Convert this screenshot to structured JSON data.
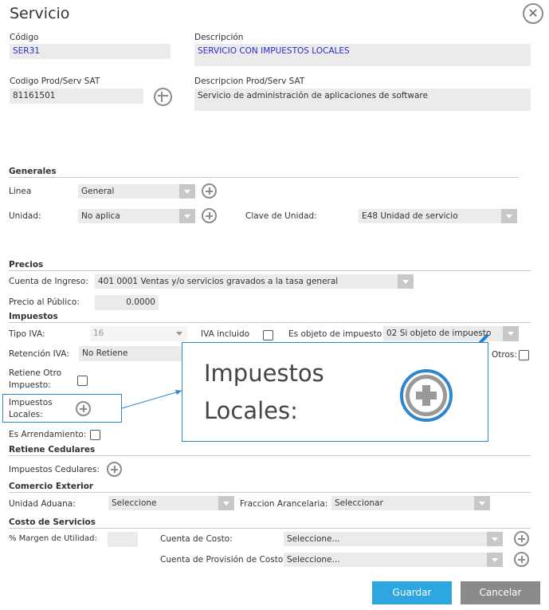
{
  "dialog": {
    "title": "Servicio",
    "close_icon": "close-icon"
  },
  "top": {
    "codigo_label": "Código",
    "codigo_value": "SER31",
    "descripcion_label": "Descripción",
    "descripcion_value": "SERVICIO CON IMPUESTOS LOCALES",
    "codigo_sat_label": "Codigo Prod/Serv SAT",
    "codigo_sat_value": "81161501",
    "desc_sat_label": "Descripcion Prod/Serv SAT",
    "desc_sat_value": "Servicio de administración de aplicaciones de software"
  },
  "generales": {
    "title": "Generales",
    "linea_label": "Linea",
    "linea_value": "General",
    "unidad_label": "Unidad:",
    "unidad_value": "No aplica",
    "clave_unidad_label": "Clave de Unidad:",
    "clave_unidad_value": "E48 Unidad de servicio"
  },
  "precios": {
    "title": "Precios",
    "cuenta_ingreso_label": "Cuenta de Ingreso:",
    "cuenta_ingreso_value": "401 0001 Ventas y/o servicios gravados a la tasa general",
    "precio_publico_label": "Precio al Público:",
    "precio_publico_value": "0.0000"
  },
  "impuestos": {
    "title": "Impuestos",
    "tipo_iva_label": "Tipo IVA:",
    "tipo_iva_value": "16",
    "iva_incluido_label": "IVA incluido",
    "objeto_impuesto_label": "Es objeto de impuesto",
    "objeto_impuesto_value": "02 Si objeto de impuesto",
    "retencion_iva_label": "Retención IVA:",
    "retencion_iva_value": "No Retiene",
    "otros_label": "Otros:",
    "retiene_otro_label_1": "Retiene Otro",
    "retiene_otro_label_2": "Impuesto:",
    "impuestos_locales_label_1": "Impuestos",
    "impuestos_locales_label_2": "Locales:",
    "arrendamiento_label": "Es Arrendamiento:"
  },
  "zoom": {
    "line1": "Impuestos",
    "line2": "Locales:"
  },
  "retiene_cedulares": {
    "title": "Retiene Cedulares",
    "impuestos_cedulares_label": "Impuestos Cedulares:"
  },
  "comercio_exterior": {
    "title": "Comercio Exterior",
    "unidad_aduana_label": "Unidad Aduana:",
    "unidad_aduana_value": "Seleccione",
    "fraccion_label": "Fraccion Arancelaria:",
    "fraccion_value": "Seleccionar"
  },
  "costo_servicios": {
    "title": "Costo de Servicios",
    "margen_label": "% Margen de Utilidad:",
    "margen_value": "",
    "cuenta_costo_label": "Cuenta de Costo:",
    "cuenta_costo_value": "Seleccione...",
    "cuenta_provision_label": "Cuenta de Provisión de Costo:",
    "cuenta_provision_value": "Seleccione..."
  },
  "buttons": {
    "guardar": "Guardar",
    "cancelar": "Cancelar"
  },
  "colors": {
    "primary": "#2ea7e0",
    "secondary": "#8a8a8a",
    "highlight": "#2c86d0",
    "link_value": "#2a2ad0"
  }
}
